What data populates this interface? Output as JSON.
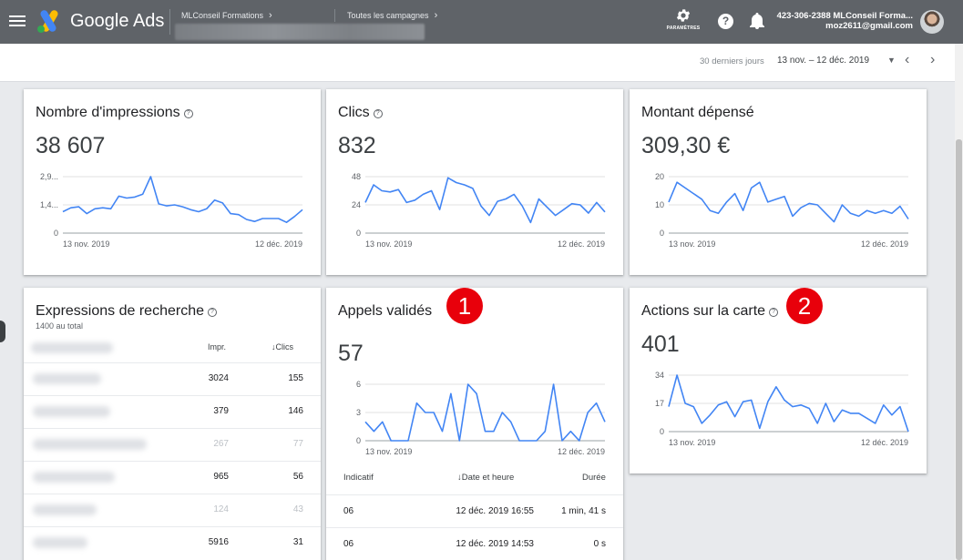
{
  "header": {
    "brand": "Google Ads",
    "account_breadcrumb": "MLConseil Formations",
    "campaigns_breadcrumb": "Toutes les campagnes",
    "settings_label": "PARAMÈTRES",
    "account_name": "423-306-2388 MLConseil Forma...",
    "account_email": "moz2611@gmail.com",
    "logo_colors": [
      "#fbbc04",
      "#4285f4",
      "#34a853"
    ]
  },
  "date_bar": {
    "label": "30 derniers jours",
    "range": "13 nov. – 12 déc. 2019"
  },
  "accent_color": "#4285f4",
  "badge_color": "#e8000b",
  "cards": {
    "impressions": {
      "title": "Nombre d'impressions",
      "value": "38 607"
    },
    "clicks": {
      "title": "Clics",
      "value": "832"
    },
    "cost": {
      "title": "Montant dépensé",
      "value": "309,30 €"
    },
    "search_terms": {
      "title": "Expressions de recherche",
      "subtitle": "1400 au total",
      "col_impr": "Impr.",
      "col_clicks": "Clics",
      "rows": [
        {
          "impr": "3024",
          "clicks": "155",
          "faded": false
        },
        {
          "impr": "379",
          "clicks": "146",
          "faded": false
        },
        {
          "impr": "267",
          "clicks": "77",
          "faded": true
        },
        {
          "impr": "965",
          "clicks": "56",
          "faded": false
        },
        {
          "impr": "124",
          "clicks": "43",
          "faded": true
        },
        {
          "impr": "5916",
          "clicks": "31",
          "faded": false
        }
      ]
    },
    "calls": {
      "title": "Appels validés",
      "badge": "1",
      "value": "57",
      "col_code": "Indicatif",
      "col_date": "Date et heure",
      "col_duration": "Durée",
      "rows": [
        {
          "code": "06",
          "date": "12 déc. 2019 16:55",
          "duration": "1 min, 41 s"
        },
        {
          "code": "06",
          "date": "12 déc. 2019 14:53",
          "duration": "0 s"
        }
      ]
    },
    "map_actions": {
      "title": "Actions sur la carte",
      "badge": "2",
      "value": "401"
    }
  },
  "chart_data": [
    {
      "type": "line",
      "series": [
        {
          "values": [
            1.1,
            1.3,
            1.35,
            1.0,
            1.25,
            1.3,
            1.25,
            1.9,
            1.8,
            1.85,
            2.0,
            2.9,
            1.5,
            1.4,
            1.45,
            1.35,
            1.2,
            1.1,
            1.25,
            1.7,
            1.55,
            1.0,
            0.95,
            0.7,
            0.6,
            0.75,
            0.75,
            0.75,
            0.55,
            0.85,
            1.2
          ]
        }
      ],
      "ylim": [
        0,
        2.9
      ],
      "yticks": [
        "0",
        "1,4...",
        "2,9..."
      ],
      "xticks": [
        "13 nov. 2019",
        "12 déc. 2019"
      ]
    },
    {
      "type": "line",
      "series": [
        {
          "values": [
            26,
            41,
            36,
            35,
            37,
            26,
            28,
            33,
            36,
            20,
            47,
            43,
            41,
            38,
            23,
            15,
            27,
            29,
            33,
            23,
            9,
            29,
            22,
            15,
            20,
            25,
            24,
            17,
            26,
            18
          ]
        }
      ],
      "ylim": [
        0,
        48
      ],
      "yticks": [
        "0",
        "24",
        "48"
      ],
      "xticks": [
        "13 nov. 2019",
        "12 déc. 2019"
      ]
    },
    {
      "type": "line",
      "series": [
        {
          "values": [
            11,
            18,
            16,
            14,
            12,
            8,
            7,
            11,
            14,
            8,
            16,
            18,
            11,
            12,
            13,
            6,
            9,
            10.5,
            10,
            7,
            4,
            10,
            7,
            6,
            8,
            7,
            8,
            7,
            9.5,
            5
          ]
        }
      ],
      "ylim": [
        0,
        20
      ],
      "yticks": [
        "0",
        "10",
        "20"
      ],
      "xticks": [
        "13 nov. 2019",
        "12 déc. 2019"
      ]
    },
    {
      "type": "line",
      "series": [
        {
          "values": [
            2,
            1,
            2,
            0,
            0,
            0,
            4,
            3,
            3,
            1,
            5,
            0,
            6,
            5,
            1,
            1,
            3,
            2,
            0,
            0,
            0,
            1,
            6,
            0,
            1,
            0,
            3,
            4,
            2
          ]
        }
      ],
      "ylim": [
        0,
        6
      ],
      "yticks": [
        "0",
        "3",
        "6"
      ],
      "xticks": [
        "13 nov. 2019",
        "12 déc. 2019"
      ]
    },
    {
      "type": "line",
      "series": [
        {
          "values": [
            15,
            34,
            17,
            15,
            5,
            10,
            16,
            18,
            9,
            18,
            19,
            2,
            18,
            27,
            19,
            15,
            16,
            14,
            5,
            17,
            6,
            13,
            11,
            11,
            8,
            5,
            16,
            10,
            15,
            0
          ]
        }
      ],
      "ylim": [
        0,
        34
      ],
      "yticks": [
        "0",
        "17",
        "34"
      ],
      "xticks": [
        "13 nov. 2019",
        "12 déc. 2019"
      ]
    }
  ]
}
